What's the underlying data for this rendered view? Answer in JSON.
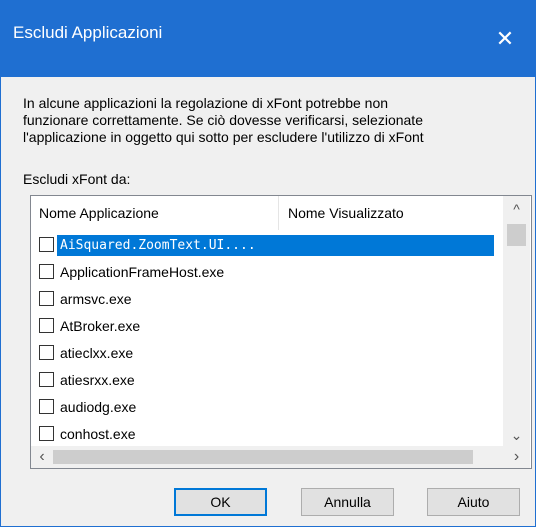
{
  "window": {
    "title": "Escludi Applicazioni",
    "close_glyph": "✕"
  },
  "description": {
    "line1": "In alcune applicazioni la regolazione di xFont potrebbe non",
    "line2": "funzionare correttamente. Se ciò dovesse verificarsi, selezionate",
    "line3": "l'applicazione in oggetto qui sotto per escludere l'utilizzo di xFont"
  },
  "list": {
    "label": "Escludi xFont da:",
    "columns": [
      "Nome Applicazione",
      "Nome Visualizzato"
    ],
    "rows": [
      {
        "name": "AiSquared.ZoomText.UI....",
        "checked": false,
        "selected": true
      },
      {
        "name": "ApplicationFrameHost.exe",
        "checked": false,
        "selected": false
      },
      {
        "name": "armsvc.exe",
        "checked": false,
        "selected": false
      },
      {
        "name": "AtBroker.exe",
        "checked": false,
        "selected": false
      },
      {
        "name": "atieclxx.exe",
        "checked": false,
        "selected": false
      },
      {
        "name": "atiesrxx.exe",
        "checked": false,
        "selected": false
      },
      {
        "name": "audiodg.exe",
        "checked": false,
        "selected": false
      },
      {
        "name": "conhost.exe",
        "checked": false,
        "selected": false
      }
    ]
  },
  "scrollbar": {
    "up": "^",
    "down": "⌄",
    "left": "‹",
    "right": "›"
  },
  "buttons": {
    "ok": "OK",
    "cancel": "Annulla",
    "help": "Aiuto"
  },
  "colors": {
    "titlebar": "#1f6fd1",
    "selection": "#0078d7"
  }
}
